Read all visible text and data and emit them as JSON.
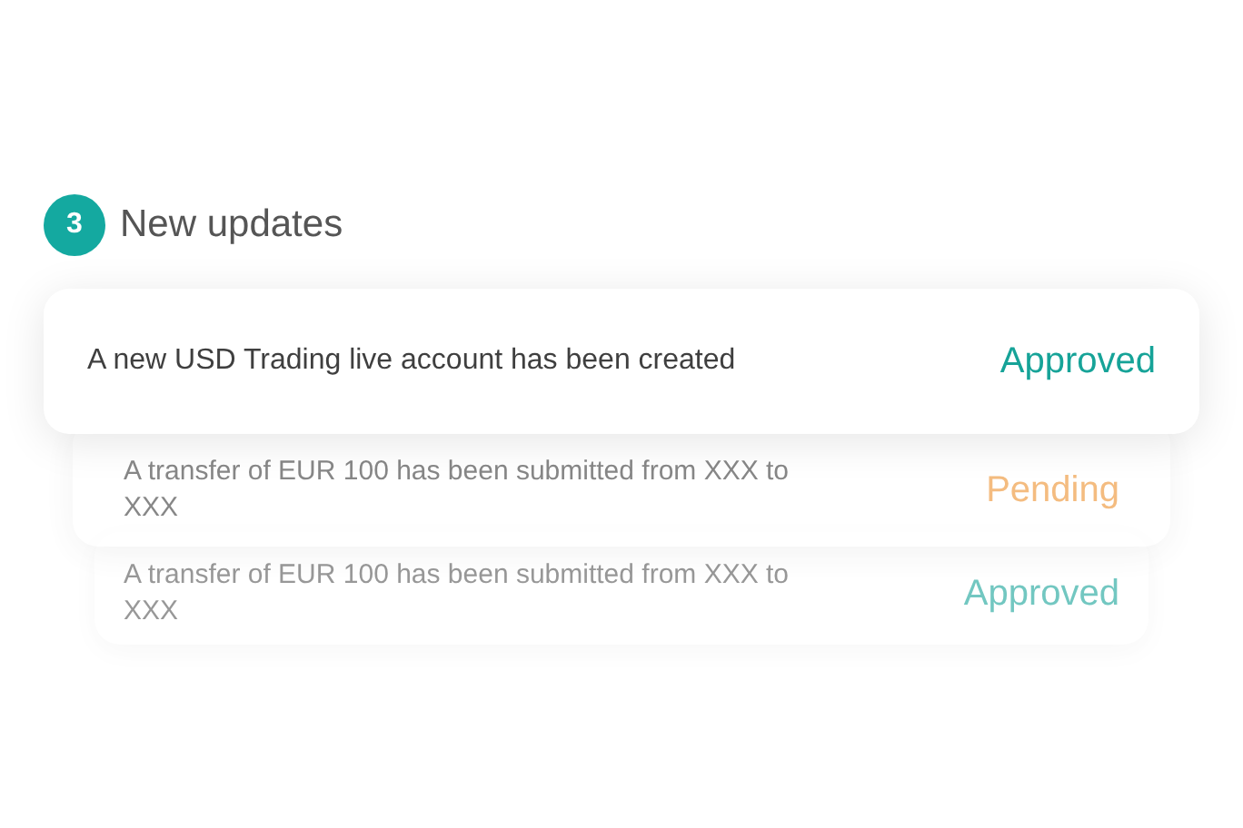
{
  "header": {
    "count": "3",
    "title": "New updates"
  },
  "updates": [
    {
      "message": "A new USD Trading live account has been created",
      "status": "Approved",
      "kind": "approved"
    },
    {
      "message": "A transfer of EUR 100 has been submitted from XXX to XXX",
      "status": "Pending",
      "kind": "pending"
    },
    {
      "message": "A transfer of EUR 100 has been submitted from XXX to XXX",
      "status": "Approved",
      "kind": "approved"
    }
  ]
}
